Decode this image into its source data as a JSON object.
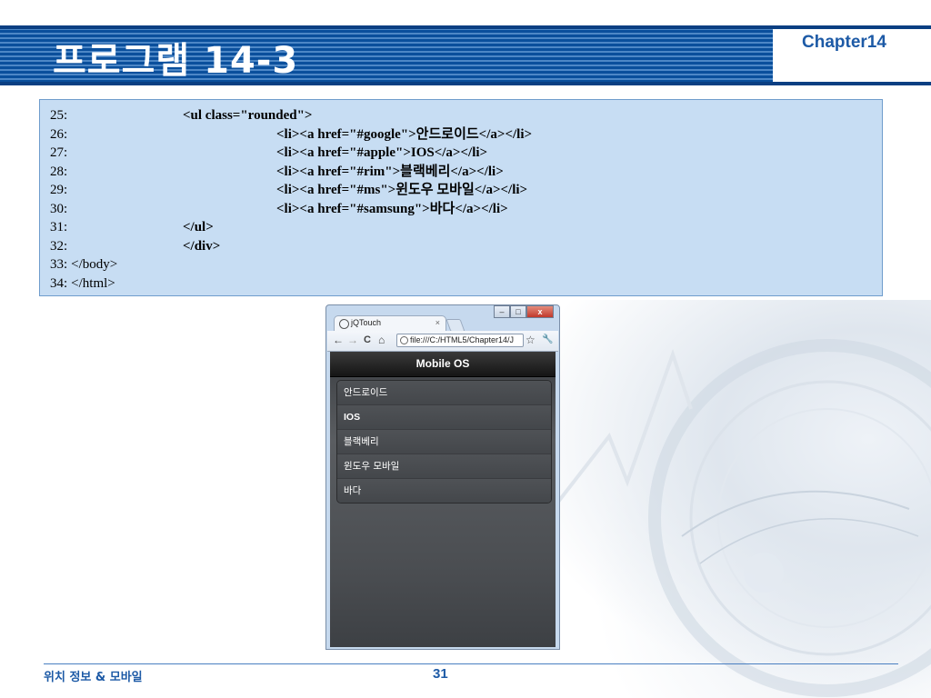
{
  "slide": {
    "title": "프로그램 14-3",
    "chapter": "Chapter14",
    "footer_left": "위치 정보 & 모바일",
    "page_number": "31"
  },
  "code": {
    "lines": [
      {
        "num": "25:",
        "text": "<ul class=\"rounded\">",
        "indent": 1
      },
      {
        "num": "26:",
        "text": "<li><a href=\"#google\">안드로이드</a></li>",
        "indent": 2
      },
      {
        "num": "27:",
        "text": "<li><a href=\"#apple\">IOS</a></li>",
        "indent": 2
      },
      {
        "num": "28:",
        "text": "<li><a href=\"#rim\">블랙베리</a></li>",
        "indent": 2
      },
      {
        "num": "29:",
        "text": "<li><a href=\"#ms\">윈도우 모바일</a></li>",
        "indent": 2
      },
      {
        "num": "30:",
        "text": "<li><a href=\"#samsung\">바다</a></li>",
        "indent": 2
      },
      {
        "num": "31:",
        "text": "</ul>",
        "indent": 1
      },
      {
        "num": "32:",
        "text": "</div>",
        "indent": 1
      },
      {
        "num": "33:",
        "text": "</body>",
        "indent": 0
      },
      {
        "num": "34:",
        "text": "</html>",
        "indent": 0
      }
    ]
  },
  "browser": {
    "tab_title": "jQTouch",
    "tab_close": "×",
    "address": "file:///C:/HTML5/Chapter14/J",
    "minimize": "–",
    "maximize": "□",
    "close": "x",
    "app_title": "Mobile OS",
    "os_items": [
      {
        "label": "안드로이드",
        "bold": false
      },
      {
        "label": "IOS",
        "bold": true
      },
      {
        "label": "블랙베리",
        "bold": false
      },
      {
        "label": "윈도우 모바일",
        "bold": false
      },
      {
        "label": "바다",
        "bold": false
      }
    ]
  },
  "icons": {
    "back": "←",
    "forward": "→",
    "reload": "C",
    "home": "⌂",
    "star": "☆",
    "wrench": "🔧"
  }
}
